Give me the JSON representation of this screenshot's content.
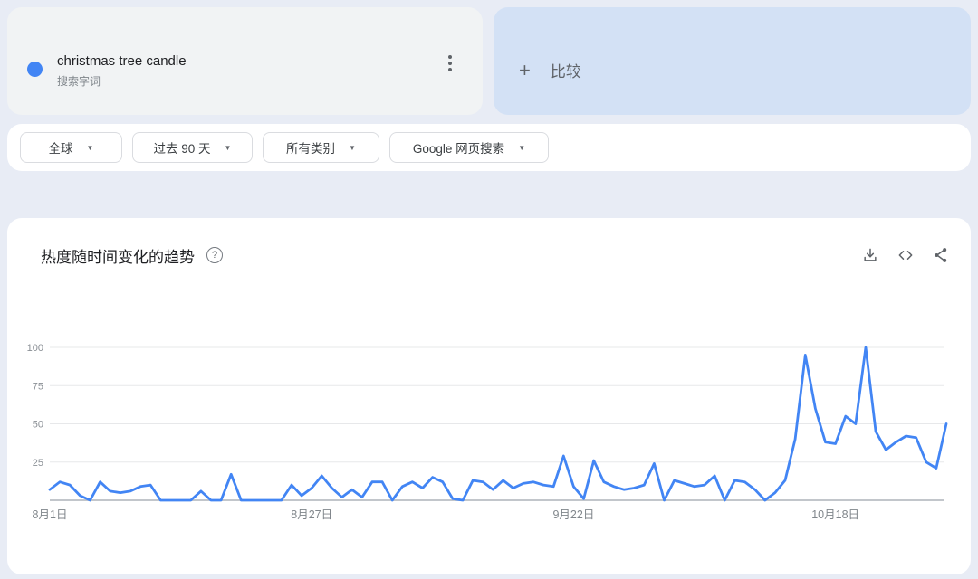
{
  "term_card": {
    "term": "christmas tree candle",
    "type_label": "搜索字词",
    "dot_color": "#4285f4"
  },
  "compare_card": {
    "plus_glyph": "+",
    "label": "比较"
  },
  "filters": [
    {
      "label": "全球"
    },
    {
      "label": "过去 90 天"
    },
    {
      "label": "所有类别"
    },
    {
      "label": "Google 网页搜索"
    }
  ],
  "icons": {
    "dropdown_glyph": "▼",
    "help_glyph": "?"
  },
  "chart_section": {
    "title": "热度随时间变化的趋势"
  },
  "chart_data": {
    "type": "line",
    "title": "热度随时间变化的趋势",
    "series_name": "christmas tree candle",
    "line_color": "#4285f4",
    "grid": true,
    "ylim": [
      0,
      100
    ],
    "y_ticks": [
      100,
      75,
      50,
      25
    ],
    "x_ticks": [
      {
        "label": "8月1日",
        "index": 0
      },
      {
        "label": "8月27日",
        "index": 26
      },
      {
        "label": "9月22日",
        "index": 52
      },
      {
        "label": "10月18日",
        "index": 78
      }
    ],
    "values": [
      7,
      12,
      10,
      3,
      0,
      12,
      6,
      5,
      6,
      9,
      10,
      0,
      0,
      0,
      0,
      6,
      0,
      0,
      17,
      0,
      0,
      0,
      0,
      0,
      10,
      3,
      8,
      16,
      8,
      2,
      7,
      2,
      12,
      12,
      0,
      9,
      12,
      8,
      15,
      12,
      1,
      0,
      13,
      12,
      7,
      13,
      8,
      11,
      12,
      10,
      9,
      29,
      9,
      1,
      26,
      12,
      9,
      7,
      8,
      10,
      24,
      0,
      13,
      11,
      9,
      10,
      16,
      0,
      13,
      12,
      7,
      0,
      5,
      13,
      40,
      95,
      60,
      38,
      37,
      55,
      50,
      100,
      45,
      33,
      38,
      42,
      41,
      25,
      21,
      50
    ]
  }
}
